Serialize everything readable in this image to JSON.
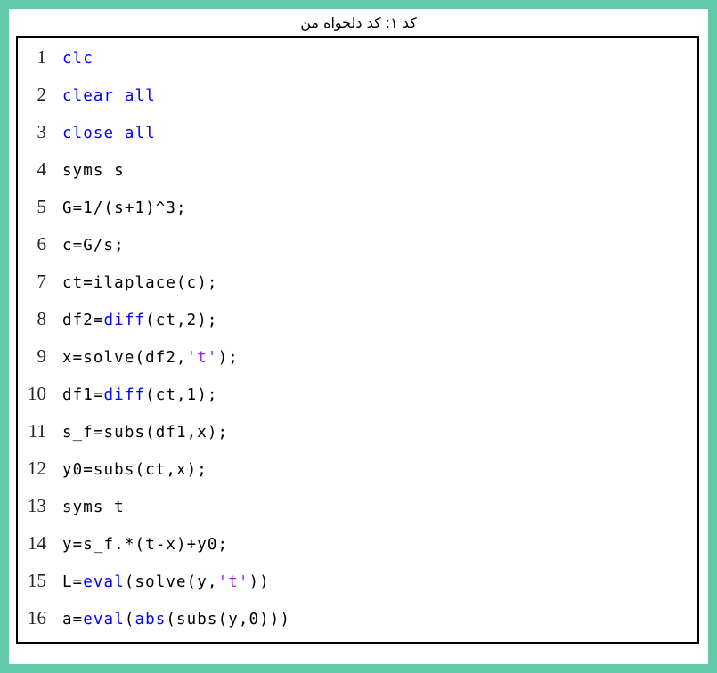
{
  "page": {
    "frame_color": "#64c9a8",
    "background_color": "#ffffff"
  },
  "caption": {
    "text": "کد ۱: کد دلخواه من"
  },
  "listing": {
    "border_color": "#000000",
    "colors": {
      "keyword": "#0000ff",
      "function": "#0000ff",
      "string": "#a020f0",
      "plain": "#000000",
      "line_number": "#222222"
    },
    "lines": [
      {
        "number": "1",
        "tokens": [
          {
            "t": "clc",
            "c": "kw"
          }
        ]
      },
      {
        "number": "2",
        "tokens": [
          {
            "t": "clear all",
            "c": "kw"
          }
        ]
      },
      {
        "number": "3",
        "tokens": [
          {
            "t": "close all",
            "c": "kw"
          }
        ]
      },
      {
        "number": "4",
        "tokens": [
          {
            "t": "syms s",
            "c": "plain"
          }
        ]
      },
      {
        "number": "5",
        "tokens": [
          {
            "t": "G=1/(s+1)^3;",
            "c": "plain"
          }
        ]
      },
      {
        "number": "6",
        "tokens": [
          {
            "t": "c=G/s;",
            "c": "plain"
          }
        ]
      },
      {
        "number": "7",
        "tokens": [
          {
            "t": "ct=ilaplace(c);",
            "c": "plain"
          }
        ]
      },
      {
        "number": "8",
        "tokens": [
          {
            "t": "df2=",
            "c": "plain"
          },
          {
            "t": "diff",
            "c": "fn"
          },
          {
            "t": "(ct,2);",
            "c": "plain"
          }
        ]
      },
      {
        "number": "9",
        "tokens": [
          {
            "t": "x=solve(df2,",
            "c": "plain"
          },
          {
            "t": "'t'",
            "c": "str"
          },
          {
            "t": ");",
            "c": "plain"
          }
        ]
      },
      {
        "number": "10",
        "tokens": [
          {
            "t": "df1=",
            "c": "plain"
          },
          {
            "t": "diff",
            "c": "fn"
          },
          {
            "t": "(ct,1);",
            "c": "plain"
          }
        ]
      },
      {
        "number": "11",
        "tokens": [
          {
            "t": "s_f=subs(df1,x);",
            "c": "plain"
          }
        ]
      },
      {
        "number": "12",
        "tokens": [
          {
            "t": "y0=subs(ct,x);",
            "c": "plain"
          }
        ]
      },
      {
        "number": "13",
        "tokens": [
          {
            "t": "syms t",
            "c": "plain"
          }
        ]
      },
      {
        "number": "14",
        "tokens": [
          {
            "t": "y=s_f.*(t-x)+y0;",
            "c": "plain"
          }
        ]
      },
      {
        "number": "15",
        "tokens": [
          {
            "t": "L=",
            "c": "plain"
          },
          {
            "t": "eval",
            "c": "fn"
          },
          {
            "t": "(solve(y,",
            "c": "plain"
          },
          {
            "t": "'t'",
            "c": "str"
          },
          {
            "t": "))",
            "c": "plain"
          }
        ]
      },
      {
        "number": "16",
        "tokens": [
          {
            "t": "a=",
            "c": "plain"
          },
          {
            "t": "eval",
            "c": "fn"
          },
          {
            "t": "(",
            "c": "plain"
          },
          {
            "t": "abs",
            "c": "fn"
          },
          {
            "t": "(subs(y,0)))",
            "c": "plain"
          }
        ]
      }
    ]
  }
}
